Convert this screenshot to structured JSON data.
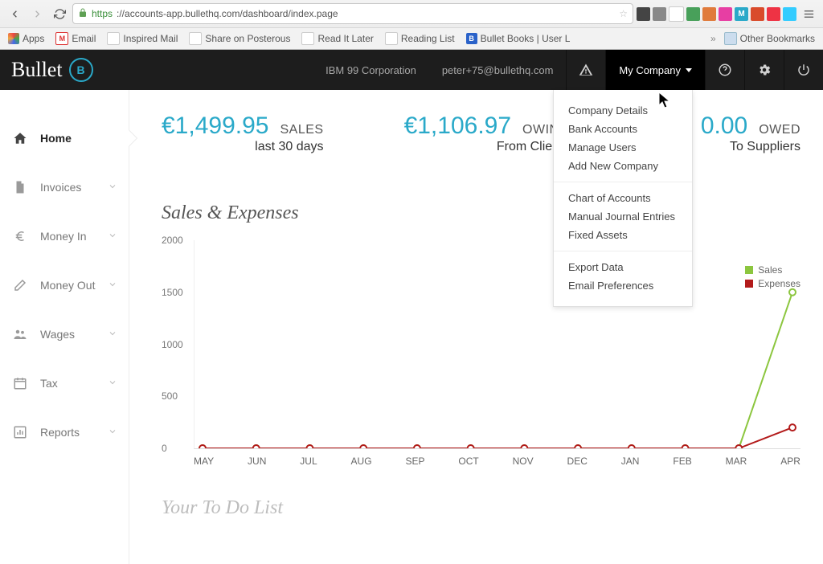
{
  "browser": {
    "url_https": "https",
    "url_rest": "://accounts-app.bullethq.com/dashboard/index.page",
    "bookmarks": [
      "Apps",
      "Email",
      "Inspired Mail",
      "Share on Posterous",
      "Read It Later",
      "Reading List",
      "Bullet Books | User L"
    ],
    "other_bookmarks": "Other Bookmarks"
  },
  "header": {
    "brand": "Bullet",
    "company": "IBM 99 Corporation",
    "email": "peter+75@bullethq.com",
    "my_company": "My Company"
  },
  "dropdown": {
    "g1": [
      "Company Details",
      "Bank Accounts",
      "Manage Users",
      "Add New Company"
    ],
    "g2": [
      "Chart of Accounts",
      "Manual Journal Entries",
      "Fixed Assets"
    ],
    "g3": [
      "Export Data",
      "Email Preferences"
    ]
  },
  "sidebar": {
    "items": [
      {
        "label": "Home",
        "expandable": false,
        "active": true
      },
      {
        "label": "Invoices",
        "expandable": true
      },
      {
        "label": "Money In",
        "expandable": true
      },
      {
        "label": "Money Out",
        "expandable": true
      },
      {
        "label": "Wages",
        "expandable": true
      },
      {
        "label": "Tax",
        "expandable": true
      },
      {
        "label": "Reports",
        "expandable": true
      }
    ]
  },
  "kpis": {
    "sales": {
      "value": "€1,499.95",
      "label": "SALES",
      "sub": "last 30 days"
    },
    "owing": {
      "value": "€1,106.97",
      "label": "OWING",
      "sub": "From Clients"
    },
    "owed": {
      "value": "0.00",
      "label": "OWED",
      "sub": "To Suppliers"
    }
  },
  "sections": {
    "sales_expenses": "Sales & Expenses",
    "todo": "Your To Do List"
  },
  "chart_data": {
    "type": "line",
    "title": "Sales & Expenses",
    "xlabel": "",
    "ylabel": "",
    "ylim": [
      0,
      2000
    ],
    "yticks": [
      0,
      500,
      1000,
      1500,
      2000
    ],
    "categories": [
      "MAY",
      "JUN",
      "JUL",
      "AUG",
      "SEP",
      "OCT",
      "NOV",
      "DEC",
      "JAN",
      "FEB",
      "MAR",
      "APR"
    ],
    "series": [
      {
        "name": "Sales",
        "color": "#8cc63f",
        "values": [
          0,
          0,
          0,
          0,
          0,
          0,
          0,
          0,
          0,
          0,
          0,
          1500
        ]
      },
      {
        "name": "Expenses",
        "color": "#b31b1b",
        "values": [
          0,
          0,
          0,
          0,
          0,
          0,
          0,
          0,
          0,
          0,
          0,
          200
        ]
      }
    ]
  }
}
